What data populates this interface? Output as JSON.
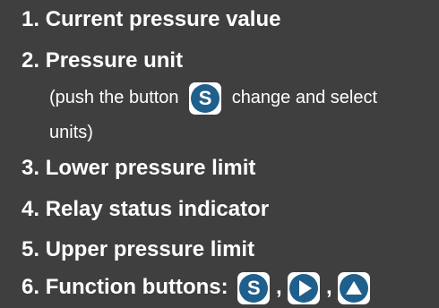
{
  "items": [
    {
      "number": "1.",
      "label": "Current pressure value"
    },
    {
      "number": "2.",
      "label": "Pressure unit"
    },
    {
      "number": "3.",
      "label": "Lower pressure limit"
    },
    {
      "number": "4.",
      "label": "Relay status indicator"
    },
    {
      "number": "5.",
      "label": "Upper pressure limit"
    },
    {
      "number": "6.",
      "label": "Function buttons:"
    }
  ],
  "note": {
    "before": "(push the button",
    "after": "change and select",
    "line2": "units)"
  },
  "buttons": {
    "s_label": "S",
    "separator": ","
  },
  "icons": [
    "s-button-icon",
    "play-button-icon",
    "up-button-icon"
  ],
  "colors": {
    "background": "#3f3f3f",
    "text": "#ffffff",
    "button_circle": "#1f5f8b",
    "button_frame": "#ffffff"
  }
}
